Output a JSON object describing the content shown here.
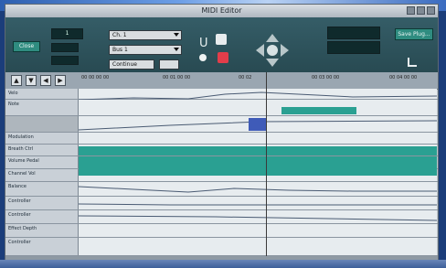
{
  "window": {
    "title": "MIDI Editor"
  },
  "toolbar": {
    "left_button": "Close",
    "counter": "1",
    "channel_select": "Ch. 1",
    "bus_select": "Bus 1",
    "mode_select": "Continue",
    "right_button": "Save Plug..."
  },
  "ruler": {
    "ticks": [
      "00 00 00 00",
      "00 01 00 00",
      "00 02",
      "00 03 00 00",
      "00 04 00 00"
    ]
  },
  "lanes": [
    {
      "label": "Velo"
    },
    {
      "label": "Note"
    },
    {
      "label": ""
    },
    {
      "label": "Modulation"
    },
    {
      "label": "Breath Ctrl"
    },
    {
      "label": "Volume Pedal"
    },
    {
      "label": "Channel Vol"
    },
    {
      "label": "Balance"
    },
    {
      "label": "Controller"
    },
    {
      "label": "Controller"
    },
    {
      "label": "Effect Depth"
    },
    {
      "label": "Controller"
    }
  ],
  "colors": {
    "accent": "#2aa092",
    "note_block": "#3f5bb8",
    "toolbar": "#2f5560"
  }
}
